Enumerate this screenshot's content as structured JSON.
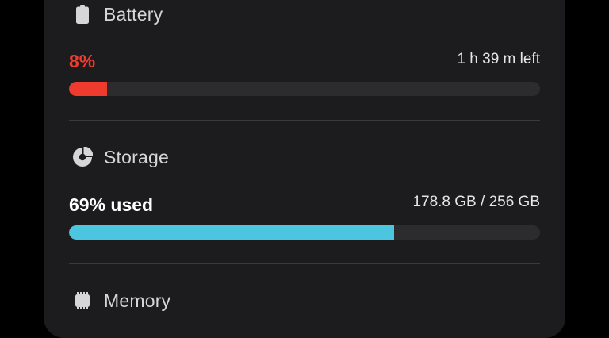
{
  "colors": {
    "battery_accent": "#ef3a2e",
    "storage_accent": "#4cc6e0",
    "title_text": "#d6d6d6",
    "value_text": "#ffffff"
  },
  "battery": {
    "title": "Battery",
    "icon": "battery-icon",
    "percent_label": "8%",
    "time_left": "1 h 39 m left",
    "level": 0.08
  },
  "storage": {
    "title": "Storage",
    "icon": "pie-chart-icon",
    "used_label": "69% used",
    "capacity": "178.8 GB / 256 GB",
    "level": 0.69
  },
  "memory": {
    "title": "Memory",
    "icon": "memory-chip-icon"
  }
}
